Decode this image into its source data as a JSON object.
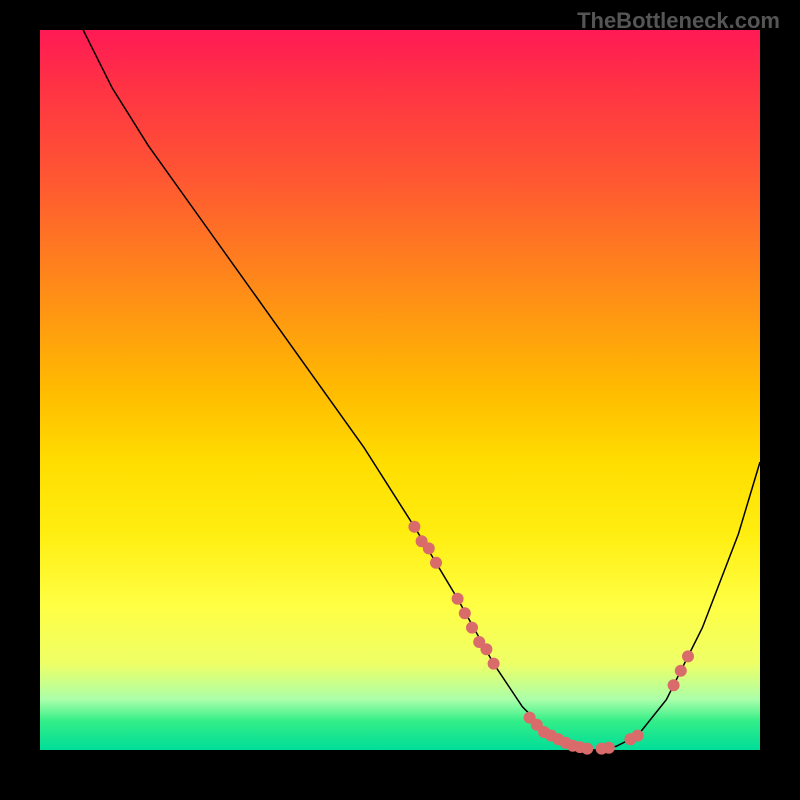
{
  "watermark": "TheBottleneck.com",
  "chart_data": {
    "type": "line",
    "title": "",
    "xlabel": "",
    "ylabel": "",
    "xlim": [
      0,
      100
    ],
    "ylim": [
      0,
      100
    ],
    "curve": [
      {
        "x": 6,
        "y": 100
      },
      {
        "x": 7,
        "y": 98
      },
      {
        "x": 10,
        "y": 92
      },
      {
        "x": 15,
        "y": 84
      },
      {
        "x": 25,
        "y": 70
      },
      {
        "x": 35,
        "y": 56
      },
      {
        "x": 45,
        "y": 42
      },
      {
        "x": 52,
        "y": 31
      },
      {
        "x": 58,
        "y": 21
      },
      {
        "x": 63,
        "y": 12
      },
      {
        "x": 67,
        "y": 6
      },
      {
        "x": 71,
        "y": 2
      },
      {
        "x": 74,
        "y": 0.5
      },
      {
        "x": 77,
        "y": 0
      },
      {
        "x": 80,
        "y": 0.5
      },
      {
        "x": 83,
        "y": 2
      },
      {
        "x": 87,
        "y": 7
      },
      {
        "x": 92,
        "y": 17
      },
      {
        "x": 97,
        "y": 30
      },
      {
        "x": 100,
        "y": 40
      }
    ],
    "points": [
      {
        "x": 52,
        "y": 31
      },
      {
        "x": 53,
        "y": 29
      },
      {
        "x": 54,
        "y": 28
      },
      {
        "x": 55,
        "y": 26
      },
      {
        "x": 58,
        "y": 21
      },
      {
        "x": 59,
        "y": 19
      },
      {
        "x": 60,
        "y": 17
      },
      {
        "x": 61,
        "y": 15
      },
      {
        "x": 62,
        "y": 14
      },
      {
        "x": 63,
        "y": 12
      },
      {
        "x": 68,
        "y": 4.5
      },
      {
        "x": 69,
        "y": 3.5
      },
      {
        "x": 70,
        "y": 2.5
      },
      {
        "x": 71,
        "y": 2
      },
      {
        "x": 72,
        "y": 1.5
      },
      {
        "x": 73,
        "y": 1
      },
      {
        "x": 74,
        "y": 0.6
      },
      {
        "x": 75,
        "y": 0.4
      },
      {
        "x": 76,
        "y": 0.2
      },
      {
        "x": 78,
        "y": 0.2
      },
      {
        "x": 79,
        "y": 0.3
      },
      {
        "x": 82,
        "y": 1.5
      },
      {
        "x": 83,
        "y": 2
      },
      {
        "x": 88,
        "y": 9
      },
      {
        "x": 89,
        "y": 11
      },
      {
        "x": 90,
        "y": 13
      }
    ],
    "color_bottom": "#00dd99",
    "color_top": "#ff1a55",
    "point_color": "#d96b6b"
  }
}
